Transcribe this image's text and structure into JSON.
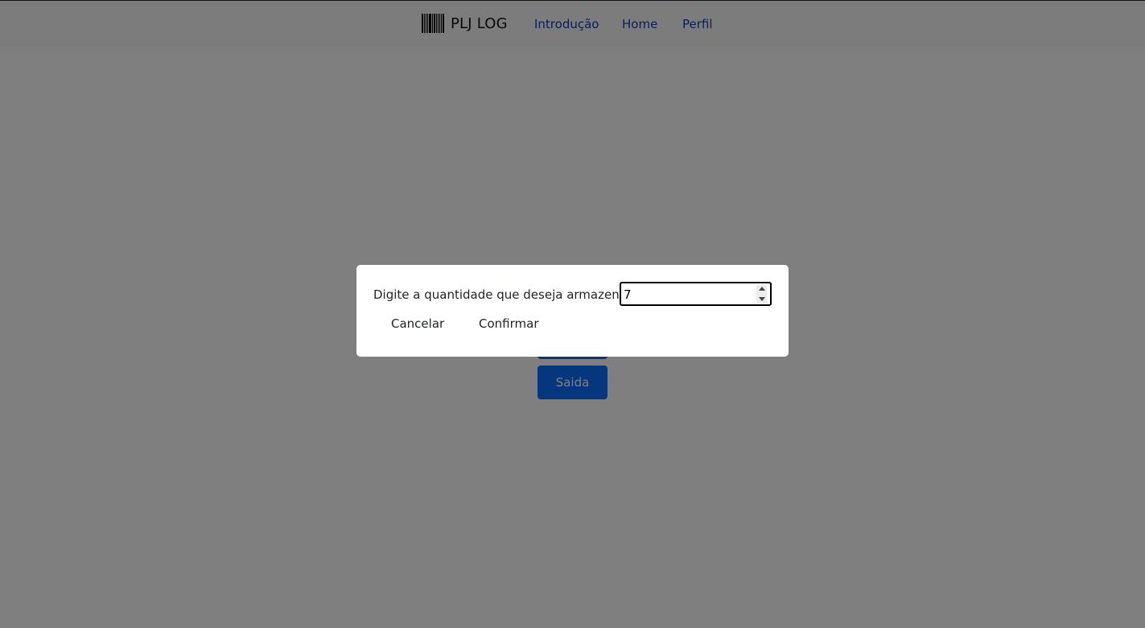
{
  "navbar": {
    "brand": "PLJ LOG",
    "links": [
      "Introdução",
      "Home",
      "Perfil"
    ]
  },
  "page": {
    "buttons": [
      "",
      "Saida"
    ]
  },
  "dialog": {
    "label": "Digite a quantidade que deseja armazenar:",
    "quantity_value": "7",
    "cancel_label": "Cancelar",
    "confirm_label": "Confirmar"
  },
  "colors": {
    "primary": "#0d6efd",
    "link": "#0d3fb8",
    "overlay": "rgba(0,0,0,0.5)"
  }
}
